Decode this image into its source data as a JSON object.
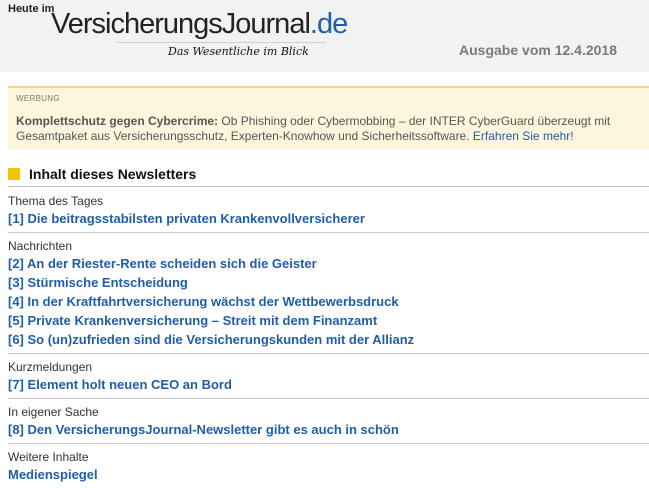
{
  "header": {
    "logo_heute": "Heute im",
    "logo_name": "VersicherungsJournal",
    "logo_tld": ".de",
    "logo_tagline": "Das Wesentliche im Blick",
    "issue": "Ausgabe vom 12.4.2018"
  },
  "ad": {
    "label": "WERBUNG",
    "headline": "Komplettschutz gegen Cybercrime:",
    "body": " Ob Phishing oder Cybermobbing – der INTER CyberGuard überzeugt mit Gesamtpaket aus Versicherungsschutz, Experten-Knowhow und Sicherheitssoftware. ",
    "link": "Erfahren Sie mehr!"
  },
  "toc": {
    "title": "Inhalt dieses Newsletters",
    "sections": [
      {
        "title": "Thema des Tages",
        "items": [
          "[1] Die beitragsstabilsten privaten Krankenvollversicherer"
        ]
      },
      {
        "title": "Nachrichten",
        "items": [
          "[2] An der Riester-Rente scheiden sich die Geister",
          "[3] Stürmische Entscheidung",
          "[4] In der Kraftfahrtversicherung wächst der Wettbewerbsdruck",
          "[5] Private Krankenversicherung – Streit mit dem Finanzamt",
          "[6] So (un)zufrieden sind die Versicherungskunden mit der Allianz"
        ]
      },
      {
        "title": "Kurzmeldungen",
        "items": [
          "[7] Element holt neuen CEO an Bord"
        ]
      },
      {
        "title": "In eigener Sache",
        "items": [
          "[8] Den VersicherungsJournal-Newsletter gibt es auch in schön"
        ]
      },
      {
        "title": "Weitere Inhalte",
        "items": [
          "Medienspiegel"
        ]
      }
    ]
  },
  "colors": {
    "link": "#1f5ea8",
    "accent": "#f2c500",
    "ad_bg": "#fdf6dc"
  }
}
